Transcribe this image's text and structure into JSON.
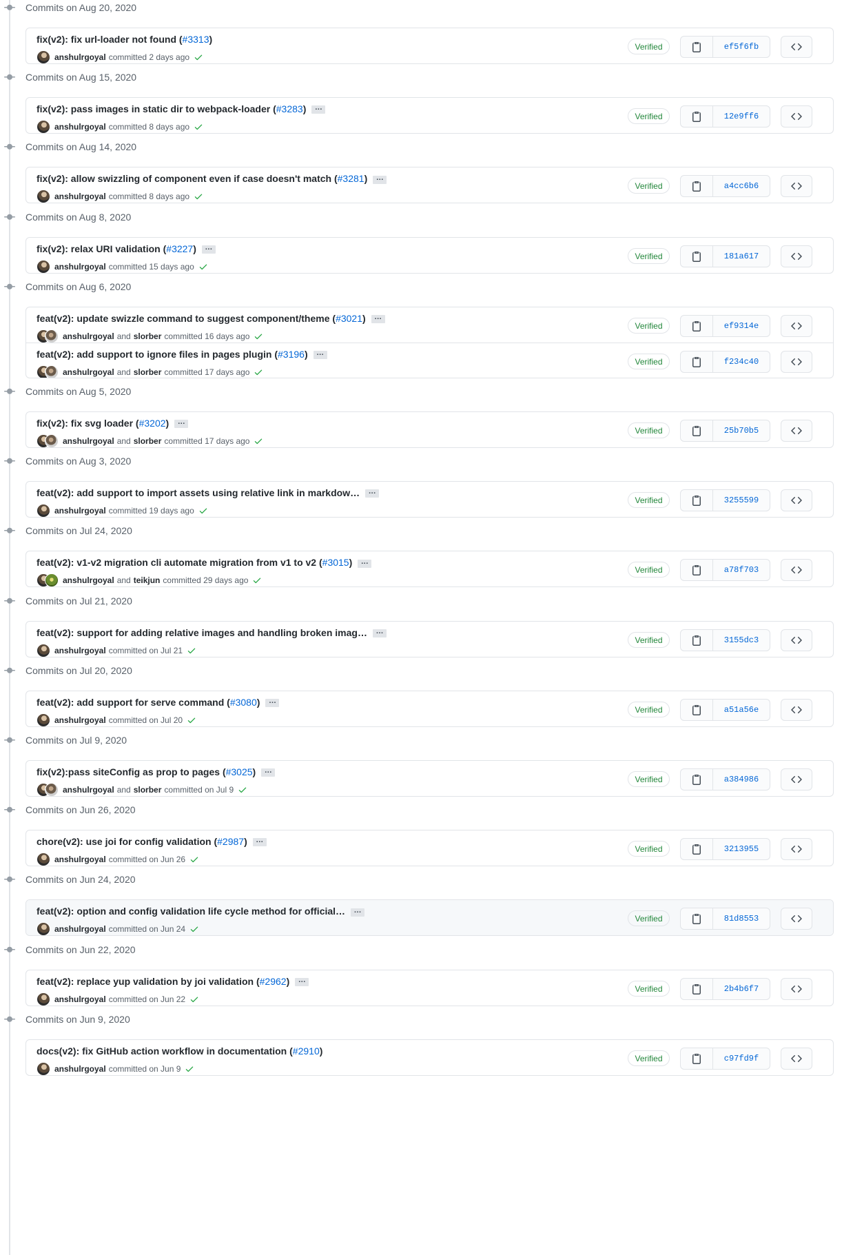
{
  "groups": [
    {
      "title": "Commits on Aug 20, 2020",
      "commits": [
        {
          "msg": "fix(v2): fix url-loader not found (",
          "pr": "#3313",
          "tail": ")",
          "more": false,
          "authors": [
            "anshulrgoyal"
          ],
          "avatars": [
            "a1"
          ],
          "when": "committed 2 days ago",
          "sha": "ef5f6fb"
        }
      ]
    },
    {
      "title": "Commits on Aug 15, 2020",
      "commits": [
        {
          "msg": "fix(v2): pass images in static dir to webpack-loader (",
          "pr": "#3283",
          "tail": ")",
          "more": true,
          "authors": [
            "anshulrgoyal"
          ],
          "avatars": [
            "a1"
          ],
          "when": "committed 8 days ago",
          "sha": "12e9ff6"
        }
      ]
    },
    {
      "title": "Commits on Aug 14, 2020",
      "commits": [
        {
          "msg": "fix(v2): allow swizzling of component even if case doesn't match (",
          "pr": "#3281",
          "tail": ")",
          "more": true,
          "authors": [
            "anshulrgoyal"
          ],
          "avatars": [
            "a1"
          ],
          "when": "committed 8 days ago",
          "sha": "a4cc6b6"
        }
      ]
    },
    {
      "title": "Commits on Aug 8, 2020",
      "commits": [
        {
          "msg": "fix(v2): relax URI validation (",
          "pr": "#3227",
          "tail": ")",
          "more": true,
          "authors": [
            "anshulrgoyal"
          ],
          "avatars": [
            "a1"
          ],
          "when": "committed 15 days ago",
          "sha": "181a617"
        }
      ]
    },
    {
      "title": "Commits on Aug 6, 2020",
      "commits": [
        {
          "msg": "feat(v2): update swizzle command to suggest component/theme (",
          "pr": "#3021",
          "tail": ")",
          "more": true,
          "authors": [
            "anshulrgoyal",
            "slorber"
          ],
          "avatars": [
            "a1",
            "a2"
          ],
          "when": "committed 16 days ago",
          "sha": "ef9314e"
        },
        {
          "msg": "feat(v2): add support to ignore files in pages plugin (",
          "pr": "#3196",
          "tail": ")",
          "more": true,
          "authors": [
            "anshulrgoyal",
            "slorber"
          ],
          "avatars": [
            "a1",
            "a2"
          ],
          "when": "committed 17 days ago",
          "sha": "f234c40"
        }
      ]
    },
    {
      "title": "Commits on Aug 5, 2020",
      "commits": [
        {
          "msg": "fix(v2): fix svg loader (",
          "pr": "#3202",
          "tail": ")",
          "more": true,
          "authors": [
            "anshulrgoyal",
            "slorber"
          ],
          "avatars": [
            "a1",
            "a2"
          ],
          "when": "committed 17 days ago",
          "sha": "25b70b5"
        }
      ]
    },
    {
      "title": "Commits on Aug 3, 2020",
      "commits": [
        {
          "msg": "feat(v2): add support to import assets using relative link in markdow…",
          "pr": "",
          "tail": "",
          "more": true,
          "authors": [
            "anshulrgoyal"
          ],
          "avatars": [
            "a1"
          ],
          "when": "committed 19 days ago",
          "sha": "3255599"
        }
      ]
    },
    {
      "title": "Commits on Jul 24, 2020",
      "commits": [
        {
          "msg": "feat(v2): v1-v2 migration cli automate migration from v1 to v2 (",
          "pr": "#3015",
          "tail": ")",
          "more": true,
          "authors": [
            "anshulrgoyal",
            "teikjun"
          ],
          "avatars": [
            "a1",
            "a3"
          ],
          "when": "committed 29 days ago",
          "sha": "a78f703"
        }
      ]
    },
    {
      "title": "Commits on Jul 21, 2020",
      "commits": [
        {
          "msg": "feat(v2): support for adding relative images and handling broken imag…",
          "pr": "",
          "tail": "",
          "more": true,
          "authors": [
            "anshulrgoyal"
          ],
          "avatars": [
            "a1"
          ],
          "when": "committed on Jul 21",
          "sha": "3155dc3"
        }
      ]
    },
    {
      "title": "Commits on Jul 20, 2020",
      "commits": [
        {
          "msg": "feat(v2): add support for serve command (",
          "pr": "#3080",
          "tail": ")",
          "more": true,
          "authors": [
            "anshulrgoyal"
          ],
          "avatars": [
            "a1"
          ],
          "when": "committed on Jul 20",
          "sha": "a51a56e"
        }
      ]
    },
    {
      "title": "Commits on Jul 9, 2020",
      "commits": [
        {
          "msg": "fix(v2):pass siteConfig as prop to pages (",
          "pr": "#3025",
          "tail": ")",
          "more": true,
          "authors": [
            "anshulrgoyal",
            "slorber"
          ],
          "avatars": [
            "a1",
            "a2"
          ],
          "when": "committed on Jul 9",
          "sha": "a384986"
        }
      ]
    },
    {
      "title": "Commits on Jun 26, 2020",
      "commits": [
        {
          "msg": "chore(v2): use joi for config validation (",
          "pr": "#2987",
          "tail": ")",
          "more": true,
          "authors": [
            "anshulrgoyal"
          ],
          "avatars": [
            "a1"
          ],
          "when": "committed on Jun 26",
          "sha": "3213955"
        }
      ]
    },
    {
      "title": "Commits on Jun 24, 2020",
      "highlight": true,
      "commits": [
        {
          "msg": "feat(v2): option and config validation life cycle method for official…",
          "pr": "",
          "tail": "",
          "more": true,
          "authors": [
            "anshulrgoyal"
          ],
          "avatars": [
            "a1"
          ],
          "when": "committed on Jun 24",
          "sha": "81d8553"
        }
      ]
    },
    {
      "title": "Commits on Jun 22, 2020",
      "commits": [
        {
          "msg": "feat(v2): replace yup validation by joi validation (",
          "pr": "#2962",
          "tail": ")",
          "more": true,
          "authors": [
            "anshulrgoyal"
          ],
          "avatars": [
            "a1"
          ],
          "when": "committed on Jun 22",
          "sha": "2b4b6f7"
        }
      ]
    },
    {
      "title": "Commits on Jun 9, 2020",
      "commits": [
        {
          "msg": "docs(v2): fix GitHub action workflow in documentation (",
          "pr": "#2910",
          "tail": ")",
          "more": false,
          "authors": [
            "anshulrgoyal"
          ],
          "avatars": [
            "a1"
          ],
          "when": "committed on Jun 9",
          "sha": "c97fd9f"
        }
      ]
    }
  ],
  "labels": {
    "verified": "Verified",
    "and": "and",
    "more": "…"
  },
  "colors": {
    "link": "#0366d6",
    "verified": "#22863a",
    "border": "#e1e4e8",
    "muted": "#586069"
  },
  "icons": {
    "group": "commit-node-icon",
    "copy": "clipboard-icon",
    "browse": "code-icon",
    "status": "check-icon"
  }
}
